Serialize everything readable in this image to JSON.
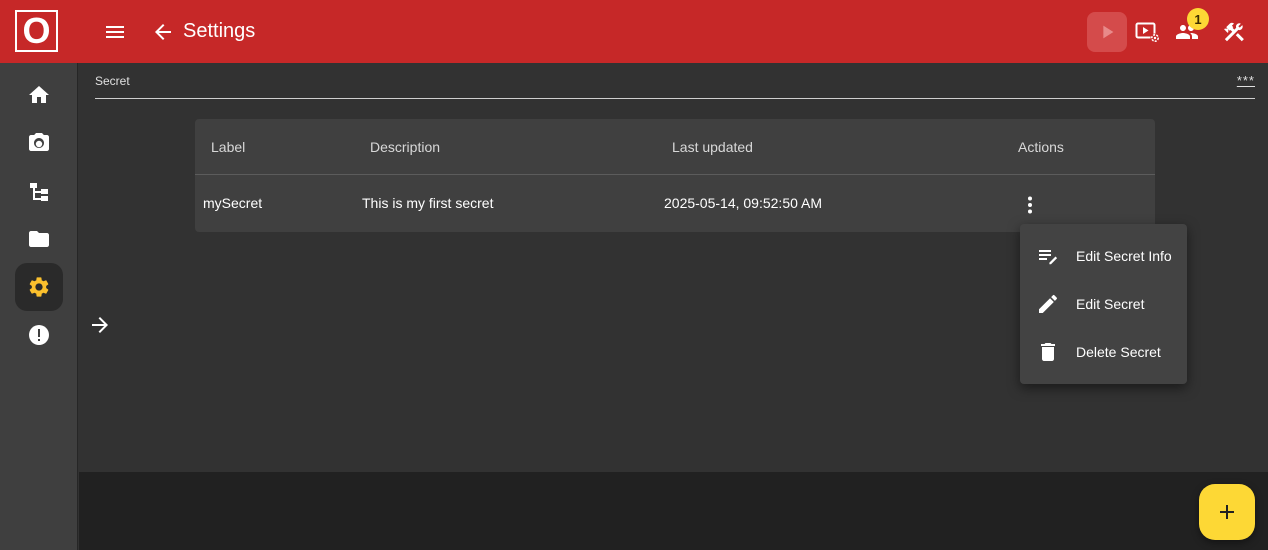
{
  "app": {
    "logo_text": "O",
    "title": "Settings"
  },
  "topbar": {
    "icons": [
      "menu-icon",
      "back-arrow-icon",
      "play-icon",
      "video-settings-icon",
      "users-icon",
      "tools-icon"
    ],
    "notification_count": "1",
    "accent_color": "#c62828",
    "badge_color": "#fdd835"
  },
  "sidebar": {
    "items": [
      {
        "icon": "home-icon",
        "active": false
      },
      {
        "icon": "camera-icon",
        "active": false
      },
      {
        "icon": "hierarchy-icon",
        "active": false
      },
      {
        "icon": "folder-icon",
        "active": false
      },
      {
        "icon": "gear-icon",
        "active": true
      },
      {
        "icon": "alert-icon",
        "active": false
      }
    ],
    "active_color": "#fbc02d"
  },
  "secret_field": {
    "label": "Secret",
    "value": "***"
  },
  "table": {
    "headers": [
      "Label",
      "Description",
      "Last updated",
      "Actions"
    ],
    "rows": [
      {
        "label": "mySecret",
        "description": "This is my first secret",
        "last_updated": "2025-05-14, 09:52:50 AM"
      }
    ]
  },
  "action_menu": {
    "items": [
      {
        "label": "Edit Secret Info",
        "icon": "edit-note-icon"
      },
      {
        "label": "Edit Secret",
        "icon": "pencil-icon"
      },
      {
        "label": "Delete Secret",
        "icon": "trash-icon"
      }
    ]
  },
  "fab": {
    "label": "+",
    "icon": "add-icon"
  }
}
